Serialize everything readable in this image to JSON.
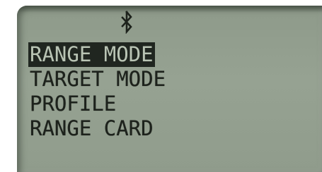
{
  "status_bar": {
    "icon": "bluetooth-icon"
  },
  "menu": {
    "items": [
      {
        "label": "RANGE MODE",
        "selected": true
      },
      {
        "label": "TARGET MODE",
        "selected": false
      },
      {
        "label": "PROFILE",
        "selected": false
      },
      {
        "label": "RANGE CARD",
        "selected": false
      }
    ]
  },
  "colors": {
    "lcd_background": "#96a292",
    "lcd_text": "#1d221c",
    "selection_background": "#202620",
    "selection_text": "#b9c4b4"
  }
}
